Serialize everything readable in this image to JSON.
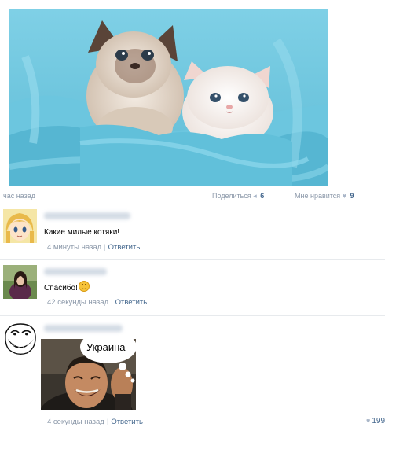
{
  "post": {
    "time": "час назад",
    "share_label": "Поделиться",
    "share_count": "6",
    "like_label": "Мне нравится",
    "like_count": "9"
  },
  "comments": [
    {
      "text": "Какие милые котяки!",
      "time": "4 минуты назад",
      "reply_label": "Ответить"
    },
    {
      "text": "Спасибо!",
      "time": "42 секунды назад",
      "reply_label": "Ответить"
    },
    {
      "image_caption": "Украина",
      "time": "4 секунды назад",
      "reply_label": "Ответить",
      "like_count": "199"
    }
  ],
  "colors": {
    "link": "#45688e",
    "meta": "#8a97a8",
    "photo_background": "#7fcce0"
  }
}
